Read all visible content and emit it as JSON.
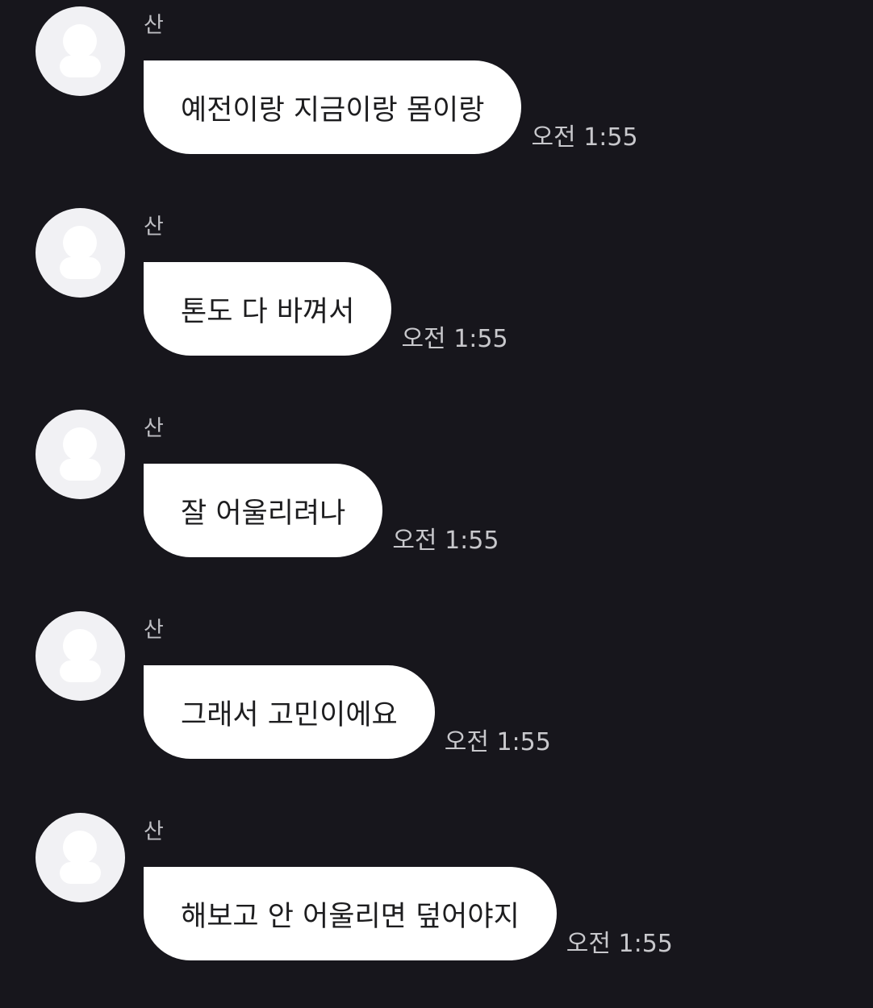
{
  "messages": [
    {
      "sender": "산",
      "text": "예전이랑 지금이랑 몸이랑",
      "time": "오전 1:55"
    },
    {
      "sender": "산",
      "text": "톤도 다 바껴서",
      "time": "오전 1:55"
    },
    {
      "sender": "산",
      "text": "잘 어울리려나",
      "time": "오전 1:55"
    },
    {
      "sender": "산",
      "text": "그래서 고민이에요",
      "time": "오전 1:55"
    },
    {
      "sender": "산",
      "text": "해보고 안 어울리면 덮어야지",
      "time": "오전 1:55"
    }
  ]
}
